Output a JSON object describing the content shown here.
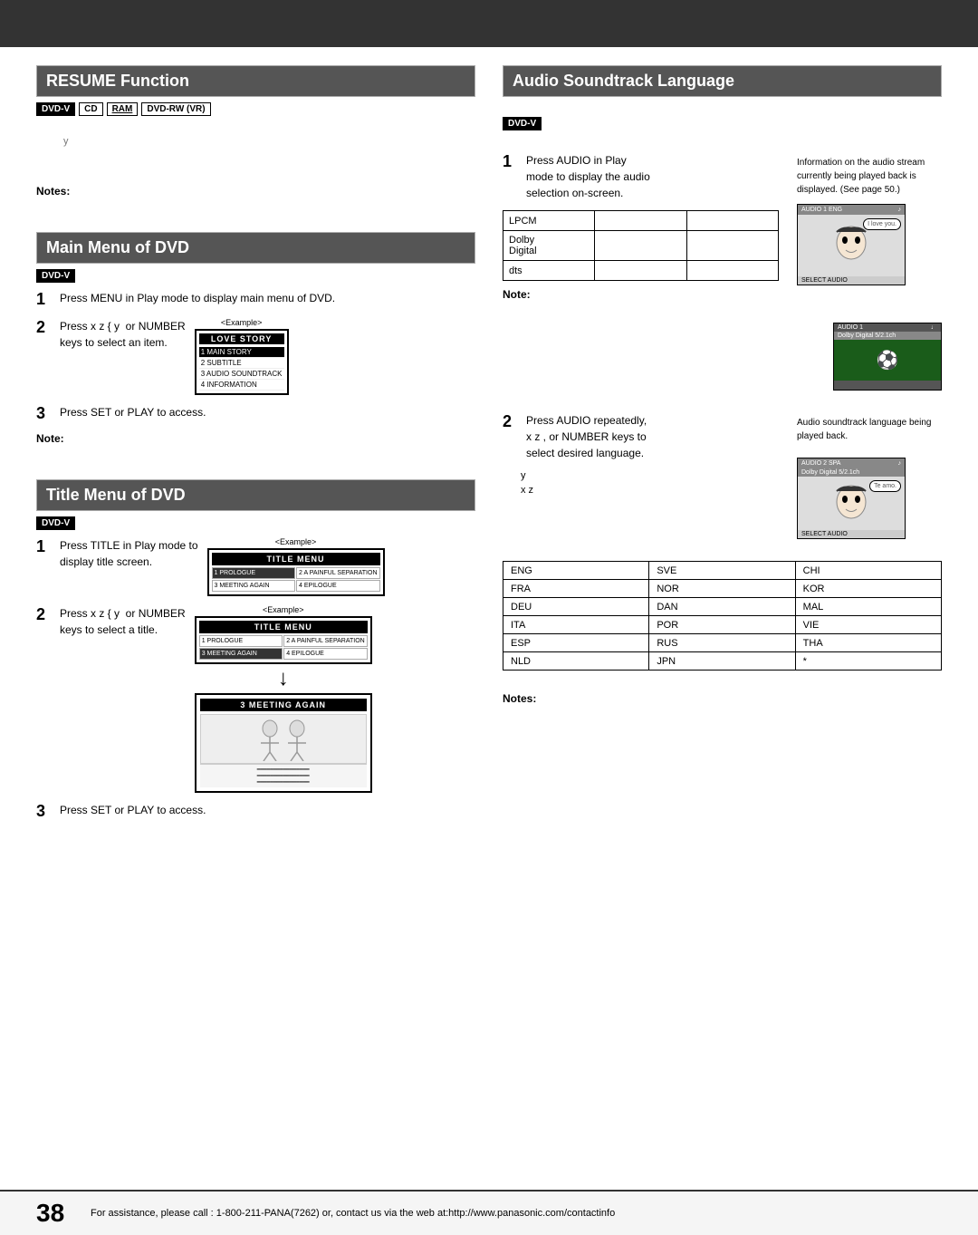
{
  "page": {
    "page_number": "38",
    "bottom_text": "For assistance, please call : 1-800-211-PANA(7262) or, contact us via the web at:http://www.panasonic.com/contactinfo"
  },
  "left": {
    "resume": {
      "header": "RESUME Function",
      "badges": [
        "DVD-V",
        "CD",
        "RAM",
        "DVD-RW (VR)"
      ],
      "highlighted_badge": "DVD-V",
      "underline_badge": "RAM",
      "notes_label": "Notes:"
    },
    "main_menu": {
      "header": "Main Menu of DVD",
      "badge": "DVD-V",
      "steps": [
        {
          "number": "1",
          "text": "Press MENU in Play mode to display main menu of DVD."
        },
        {
          "number": "2",
          "text": "Press x z { y  or NUMBER keys to select an item.",
          "example_label": "<Example>",
          "menu_title": "LOVE STORY",
          "menu_items": [
            "MAIN STORY",
            "SUBTITLE",
            "AUDIO SOUNDTRACK",
            "INFORMATION"
          ]
        },
        {
          "number": "3",
          "text": "Press SET or PLAY to access."
        }
      ],
      "note_label": "Note:"
    },
    "title_menu": {
      "header": "Title Menu of DVD",
      "badge": "DVD-V",
      "steps": [
        {
          "number": "1",
          "text": "Press TITLE in Play mode to display title screen.",
          "example_label": "<Example>",
          "menu_title": "TITLE MENU"
        },
        {
          "number": "2",
          "text": "Press x z { y  or NUMBER keys to select a title.",
          "example_label": "<Example>",
          "menu_title": "TITLE MENU"
        },
        {
          "number": "3",
          "text": "Press SET or PLAY to access."
        }
      ]
    }
  },
  "right": {
    "audio": {
      "header": "Audio Soundtrack Language",
      "badge": "DVD-V",
      "step1": {
        "number": "1",
        "text": "Press AUDIO in Play mode to display the audio selection on-screen.",
        "side_text": "Information on the audio stream currently being played back is displayed. (See page 50.)",
        "audio_options": [
          "LPCM",
          "Dolby Digital",
          "dts"
        ],
        "note_label": "Note:"
      },
      "step2": {
        "number": "2",
        "text": "Press AUDIO repeatedly, x z , or NUMBER keys to select desired language.",
        "side_text": "Audio soundtrack language being played back.",
        "y_label": "y",
        "xz_label": "x z"
      },
      "language_table": {
        "col1": [
          "ENG",
          "FRA",
          "DEU",
          "ITA",
          "ESP",
          "NLD"
        ],
        "col2": [
          "SVE",
          "NOR",
          "DAN",
          "POR",
          "RUS",
          "JPN"
        ],
        "col3": [
          "CHI",
          "KOR",
          "MAL",
          "VIE",
          "THA",
          "*"
        ]
      },
      "notes_label": "Notes:"
    }
  }
}
